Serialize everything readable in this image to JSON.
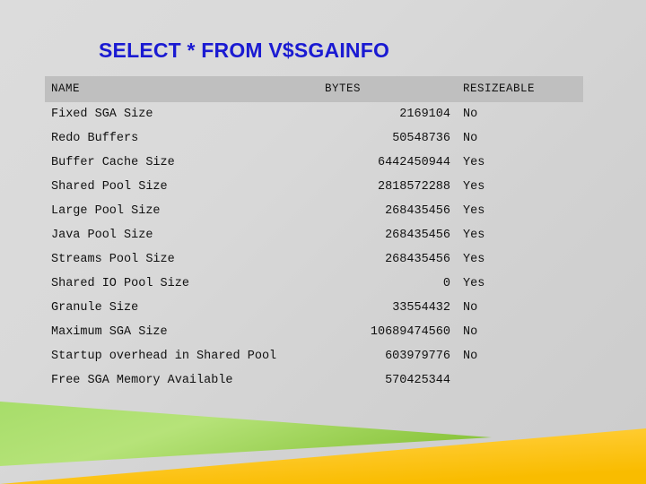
{
  "slide": {
    "title": "SELECT * FROM V$SGAINFO",
    "title_color": "#1a1ad2",
    "background_color": "#d9d9d9",
    "accent_green": "#92d14f",
    "accent_yellow": "#ffc000"
  },
  "table": {
    "header_background": "#bfbfbf",
    "columns": [
      {
        "key": "name",
        "label": "NAME"
      },
      {
        "key": "bytes",
        "label": "BYTES"
      },
      {
        "key": "resizeable",
        "label": "RESIZEABLE"
      }
    ],
    "rows": [
      {
        "name": "Fixed SGA Size",
        "bytes": "2169104",
        "resizeable": "No"
      },
      {
        "name": "Redo Buffers",
        "bytes": "50548736",
        "resizeable": "No"
      },
      {
        "name": "Buffer Cache Size",
        "bytes": "6442450944",
        "resizeable": "Yes"
      },
      {
        "name": "Shared Pool Size",
        "bytes": "2818572288",
        "resizeable": "Yes"
      },
      {
        "name": "Large Pool Size",
        "bytes": "268435456",
        "resizeable": "Yes"
      },
      {
        "name": "Java Pool Size",
        "bytes": "268435456",
        "resizeable": "Yes"
      },
      {
        "name": "Streams Pool Size",
        "bytes": "268435456",
        "resizeable": "Yes"
      },
      {
        "name": "Shared IO Pool Size",
        "bytes": "0",
        "resizeable": "Yes"
      },
      {
        "name": "Granule Size",
        "bytes": "33554432",
        "resizeable": "No"
      },
      {
        "name": "Maximum SGA Size",
        "bytes": "10689474560",
        "resizeable": "No"
      },
      {
        "name": "Startup overhead in Shared Pool",
        "bytes": "603979776",
        "resizeable": "No"
      },
      {
        "name": "Free SGA Memory Available",
        "bytes": "570425344",
        "resizeable": ""
      }
    ]
  }
}
